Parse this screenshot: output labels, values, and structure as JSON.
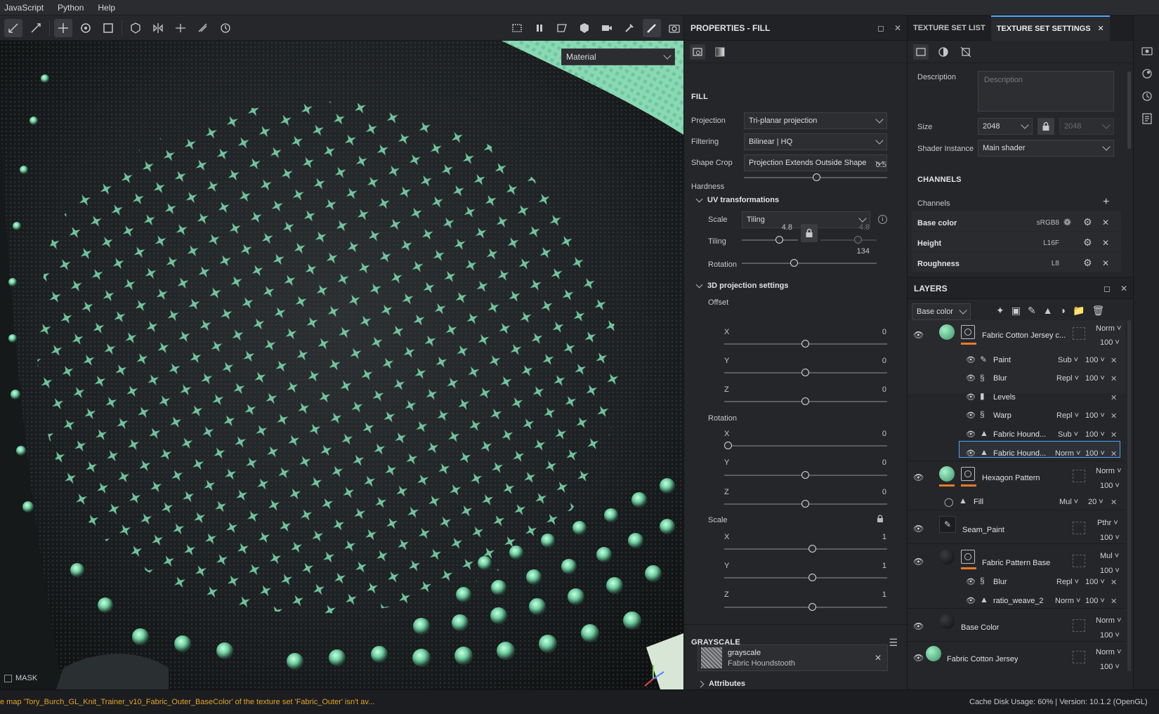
{
  "menu": [
    "JavaScript",
    "Python",
    "Help"
  ],
  "viewport": {
    "material_dropdown": "Material",
    "mask_label": "MASK"
  },
  "properties": {
    "title": "PROPERTIES - FILL",
    "fill_section": "FILL",
    "projection_label": "Projection",
    "projection_value": "Tri-planar projection",
    "filtering_label": "Filtering",
    "filtering_value": "Bilinear | HQ",
    "shapecrop_label": "Shape Crop",
    "shapecrop_value": "Projection Extends Outside Shape",
    "hardness_label": "Hardness",
    "hardness_value": "0.5",
    "uv_title": "UV transformations",
    "scale_label": "Scale",
    "scale_value": "Tiling",
    "tiling_label": "Tiling",
    "tiling_u": "4.8",
    "tiling_v": "4.8",
    "rotation_label": "Rotation",
    "rotation_value": "134",
    "proj3d_title": "3D projection settings",
    "offset_label": "Offset",
    "offset": {
      "x": "0",
      "y": "0",
      "z": "0"
    },
    "rot3d_label": "Rotation",
    "rot3d": {
      "x": "0",
      "y": "0",
      "z": "0"
    },
    "scale3d_label": "Scale",
    "scale3d": {
      "x": "1",
      "y": "1",
      "z": "1"
    },
    "axis": {
      "x": "X",
      "y": "Y",
      "z": "Z"
    },
    "grayscale_section": "GRAYSCALE",
    "grayscale_name": "grayscale",
    "grayscale_resource": "Fabric Houndstooth",
    "attributes": "Attributes"
  },
  "texset": {
    "tab_list": "TEXTURE SET LIST",
    "tab_settings": "TEXTURE SET SETTINGS",
    "description_label": "Description",
    "description_placeholder": "Description",
    "size_label": "Size",
    "size_value": "2048",
    "size_value2": "2048",
    "shader_label": "Shader Instance",
    "shader_value": "Main shader",
    "channels_section": "CHANNELS",
    "channels_label": "Channels",
    "channels": [
      {
        "name": "Base color",
        "fmt": "sRGB8"
      },
      {
        "name": "Height",
        "fmt": "L16F"
      },
      {
        "name": "Roughness",
        "fmt": "L8"
      }
    ]
  },
  "layers": {
    "title": "LAYERS",
    "channel_dropdown": "Base color",
    "items": [
      {
        "name": "Fabric Cotton Jersey c...",
        "blend": "Norm",
        "opacity": "100"
      },
      {
        "name": "Paint",
        "blend": "Sub",
        "opacity": "100"
      },
      {
        "name": "Blur",
        "blend": "Repl",
        "opacity": "100"
      },
      {
        "name": "Levels",
        "blend": "",
        "opacity": ""
      },
      {
        "name": "Warp",
        "blend": "Repl",
        "opacity": "100"
      },
      {
        "name": "Fabric Hound...",
        "blend": "Sub",
        "opacity": "100"
      },
      {
        "name": "Fabric Hound...",
        "blend": "Norm",
        "opacity": "100"
      },
      {
        "name": "Hexagon Pattern",
        "blend": "Norm",
        "opacity": "100"
      },
      {
        "name": "Fill",
        "blend": "Mul",
        "opacity": "20"
      },
      {
        "name": "Seam_Paint",
        "blend": "Pthr",
        "opacity": "100"
      },
      {
        "name": "Fabric Pattern Base",
        "blend": "Mul",
        "opacity": "100"
      },
      {
        "name": "Blur",
        "blend": "Repl",
        "opacity": "100"
      },
      {
        "name": "ratio_weave_2",
        "blend": "Norm",
        "opacity": "100"
      },
      {
        "name": "Base Color",
        "blend": "Norm",
        "opacity": "100"
      },
      {
        "name": "Fabric Cotton Jersey",
        "blend": "Norm",
        "opacity": "100"
      }
    ]
  },
  "status": {
    "message": "e map 'Tory_Burch_GL_Knit_Trainer_v10_Fabric_Outer_BaseColor' of the texture set 'Fabric_Outer' isn't av...",
    "right": "Cache Disk Usage:   60% | Version: 10.1.2 (OpenGL)"
  },
  "colors": {
    "accent": "#4ea3ff",
    "orange": "#e87a2a",
    "mint": "#7fe0b0",
    "warning": "#e0a52a"
  }
}
